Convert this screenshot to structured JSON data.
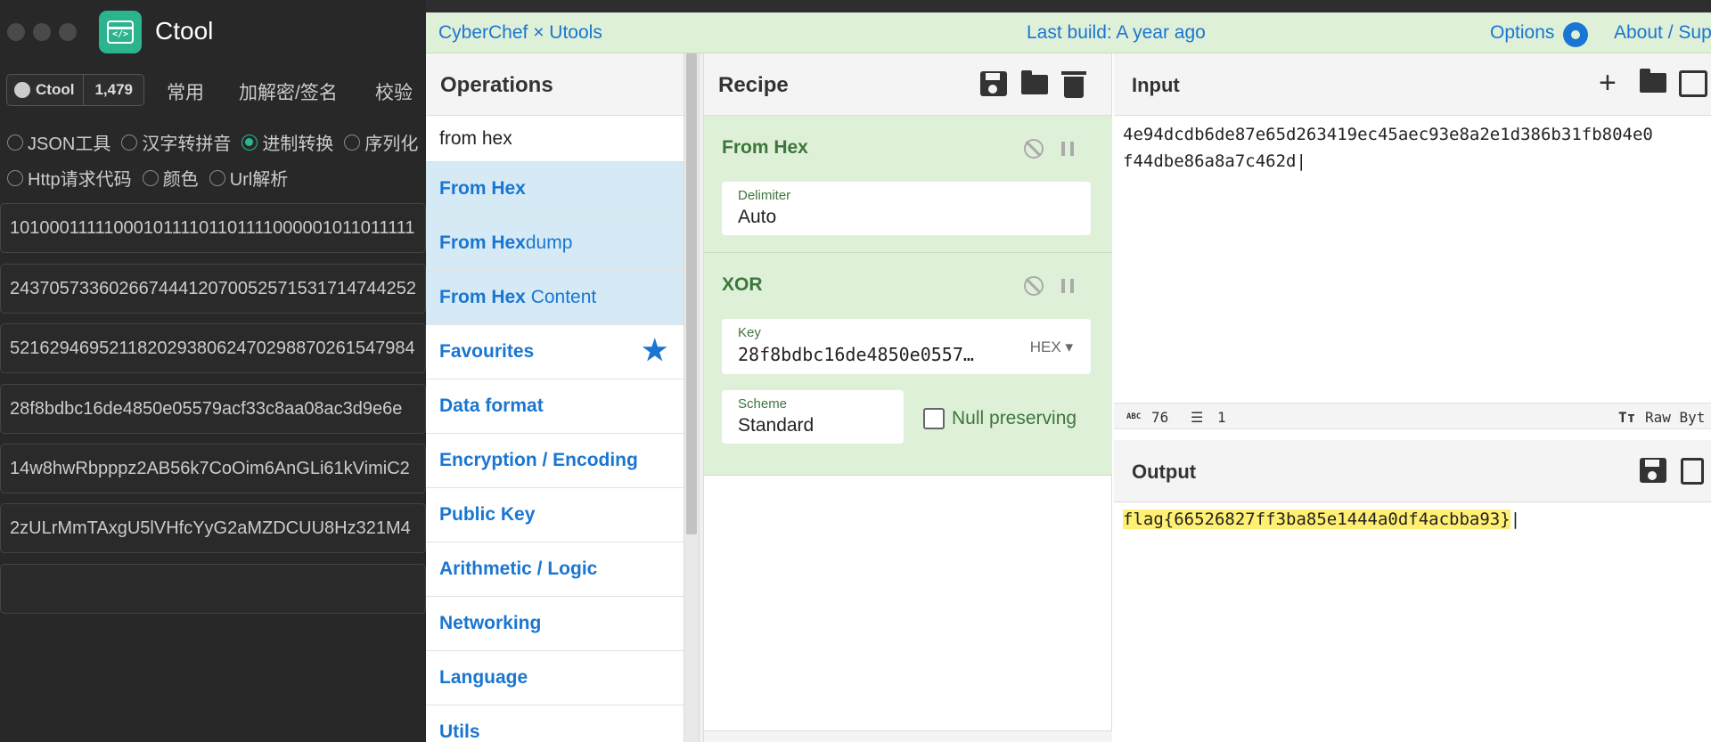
{
  "ctool": {
    "title": "Ctool",
    "github": {
      "label": "Ctool",
      "count": "1,479"
    },
    "nav": [
      "常用",
      "加解密/签名",
      "校验"
    ],
    "radios_row1": [
      {
        "label": "JSON工具",
        "selected": false
      },
      {
        "label": "汉字转拼音",
        "selected": false
      },
      {
        "label": "进制转换",
        "selected": true
      },
      {
        "label": "序列化",
        "selected": false
      }
    ],
    "radios_row2": [
      {
        "label": "Http请求代码",
        "selected": false
      },
      {
        "label": "颜色",
        "selected": false
      },
      {
        "label": "Url解析",
        "selected": false
      }
    ],
    "values": [
      "1010001111100010111101101111000001011011111",
      "24370573360266744412070052571531714744252",
      "52162946952118202938062470298870261547984",
      "28f8bdbc16de4850e05579acf33c8aa08ac3d9e6e",
      "14w8hwRbpppz2AB56k7CoOim6AnGLi61kVimiC2",
      "2zULrMmTAxgU5lVHfcYyG2aMZDCUU8Hz321M4"
    ],
    "accent": "#2bb58f"
  },
  "cyberchef": {
    "brand": "CyberChef × Utools",
    "build": "Last build: A year ago",
    "options": "Options",
    "about": "About / Sup",
    "accent": "#1976d2",
    "operations": {
      "title": "Operations",
      "search": "from hex",
      "results": [
        {
          "bold": "From Hex",
          "rest": ""
        },
        {
          "bold": "From Hex",
          "rest": "dump"
        },
        {
          "bold": "From Hex",
          "rest": " Content"
        }
      ],
      "categories": [
        "Favourites",
        "Data format",
        "Encryption / Encoding",
        "Public Key",
        "Arithmetic / Logic",
        "Networking",
        "Language",
        "Utils"
      ]
    },
    "recipe": {
      "title": "Recipe",
      "ops": [
        {
          "name": "From Hex",
          "fields": [
            {
              "label": "Delimiter",
              "value": "Auto"
            }
          ]
        },
        {
          "name": "XOR",
          "fields": [
            {
              "label": "Key",
              "value": "28f8bdbc16de4850e0557…",
              "type": "HEX"
            },
            {
              "label": "Scheme",
              "value": "Standard"
            }
          ],
          "checkbox": "Null preserving"
        }
      ]
    },
    "input": {
      "title": "Input",
      "line1": "4e94dcdb6de87e65d263419ec45aec93e8a2e1d386b31fb804e0",
      "line2": "f44dbe86a8a7c462d",
      "abc_label": "ABC",
      "length": "76",
      "lines": "1",
      "raw": "Raw Byt",
      "tt_icon": "Tт"
    },
    "output": {
      "title": "Output",
      "text": "flag{66526827ff3ba85e1444a0df4acbba93}"
    }
  }
}
